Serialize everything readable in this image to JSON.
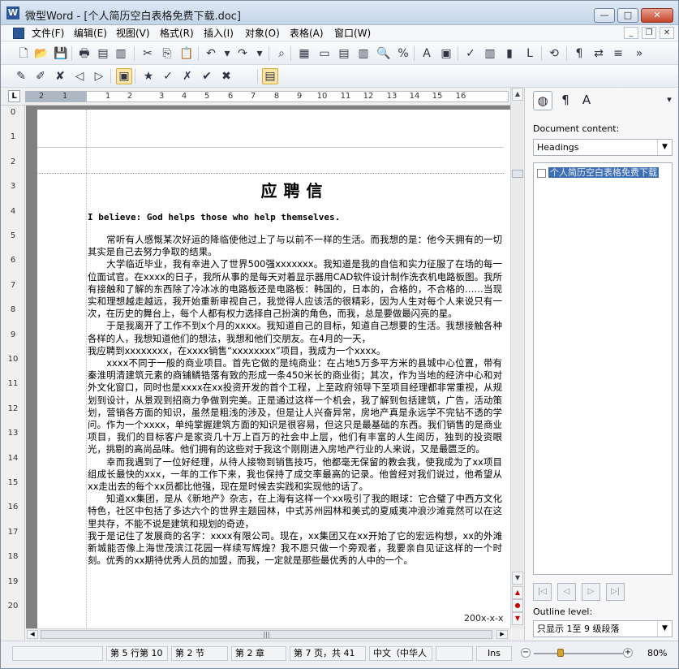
{
  "window": {
    "title": "微型Word - [个人简历空白表格免费下载.doc]",
    "min_glyph": "—",
    "max_glyph": "□",
    "close_glyph": "✕"
  },
  "menu": {
    "items": [
      "文件(F)",
      "编辑(E)",
      "视图(V)",
      "格式(R)",
      "插入(I)",
      "对象(O)",
      "表格(A)",
      "窗口(W)"
    ],
    "mdi_min": "_",
    "mdi_restore": "❐",
    "mdi_close": "✕"
  },
  "toolbar1": {
    "icons": [
      "new-document-icon",
      "open-folder-icon",
      "save-icon",
      "print-icon",
      "pdf-export-icon",
      "print-preview-icon",
      "cut-icon",
      "copy-icon",
      "paste-icon",
      "undo-icon",
      "undo-dropdown-icon",
      "redo-icon",
      "redo-dropdown-icon",
      "find-icon",
      "page-number-icon",
      "insert-frame-icon",
      "insert-table-icon",
      "insert-columns-icon",
      "zoom-icon",
      "percent-icon",
      "font-color-icon",
      "insert-symbol-icon",
      "spell-check-icon",
      "chart-icon",
      "shape-icon",
      "bookmark-icon",
      "sync-icon",
      "paragraph-mark-icon",
      "replace-icon",
      "stack-icon",
      "more-icon"
    ],
    "glyphs": [
      "🗋",
      "📂",
      "💾",
      "🖶",
      "▤",
      "▥",
      "✂",
      "⎘",
      "📋",
      "↶",
      "▾",
      "↷",
      "▾",
      "⌕",
      "▦",
      "▭",
      "▤",
      "▥",
      "🔍",
      "%",
      "A",
      "▣",
      "✓",
      "▥",
      "▮",
      "L",
      "⟲",
      "¶",
      "⇄",
      "≡",
      "»"
    ]
  },
  "toolbar2": {
    "icons": [
      "highlight-icon",
      "edit-note-icon",
      "delete-note-icon",
      "prev-note-icon",
      "next-note-icon",
      "show-notes-icon",
      "track-changes-icon",
      "accept-change-icon",
      "reject-change-icon",
      "accept-all-icon",
      "reject-all-icon",
      "review-pane-icon"
    ],
    "glyphs": [
      "✎",
      "✐",
      "✘",
      "◁",
      "▷",
      "▣",
      "★",
      "✓",
      "✗",
      "✔",
      "✖",
      "▤"
    ]
  },
  "ruler": {
    "corner": "L",
    "h_ticks": [
      "2",
      "1",
      "1",
      "2",
      "3",
      "4",
      "5",
      "6",
      "7",
      "8",
      "9",
      "10",
      "11",
      "12",
      "13",
      "14",
      "15",
      "16"
    ],
    "v_ticks": [
      "0",
      "1",
      "2",
      "3",
      "4",
      "5",
      "6",
      "7",
      "8",
      "9",
      "10",
      "11",
      "12",
      "13",
      "14",
      "15",
      "16",
      "17",
      "18",
      "19",
      "20"
    ]
  },
  "document": {
    "title": "应聘信",
    "motto": "I believe: God helps those who help themselves.",
    "paragraphs": [
      "　　常听有人感慨某次好运的降临使他过上了与以前不一样的生活。而我想的是：他今天拥有的一切其实是自己去努力争取的结果。",
      "　　大学临近毕业，我有幸进入了世界500强xxxxxxx。我知道是我的自信和实力征服了在场的每一位面试官。在xxxx的日子，我所从事的是每天对着显示器用CAD软件设计制作洗衣机电路板图。我所有接触和了解的东西除了冷冰冰的电路板还是电路板：韩国的，日本的，合格的，不合格的……当现实和理想越走越远，我开始重新审视自己，我觉得人应该活的很精彩，因为人生对每个人来说只有一次，在历史的舞台上，每个人都有权力选择自己扮演的角色，而我，总是要做最闪亮的星。",
      "　　于是我离开了工作不到x个月的xxxx。我知道自己的目标，知道自己想要的生活。我想接触各种各样的人，我想知道他们的想法，我想和他们交朋友。在4月的一天，",
      "我应聘到xxxxxxxx，在xxxx销售“xxxxxxxx”项目，我成为一个xxxx。",
      "　　xxxx不同于一般的商业项目。首先它做的是纯商业：在占地5万多平方米的县城中心位置，带有秦淮明清建筑元素的商铺鳞锆落有致的形成一条450米长的商业街；其次，作为当地的经济中心和对外文化窗口，同时也是xxxx在xx投资开发的首个工程，上至政府领导下至项目经理都非常重视，从规划到设计，从景观到招商力争做到完美。正是通过这样一个机会，我了解到包括建筑，广告，活动策划，营销各方面的知识，虽然是粗浅的涉及，但是让人兴奋异常，房地产真是永远学不完钻不透的学问。作为一个xxxx，单纯掌握建筑方面的知识是很容易，但这只是最基础的东西。我们销售的是商业项目，我们的目标客户是家资几十万上百万的社会中上层，他们有丰富的人生阅历，独到的投资眼光，挑剔的高尚品味。他们拥有的这些对于我这个刚刚进入房地产行业的人来说，又是最匮乏的。",
      "　　幸而我遇到了一位好经理，从待人接物到销售技巧，他都毫无保留的教会我，使我成为了xx项目组成长最快的xxx，一年的工作下来，我也保持了成交率最高的记录。他曾经对我们说过，他希望从xx走出去的每个xx员都比他强，现在是时候去实践和实现他的话了。",
      "　　知道xx集团，是从《新地产》杂志，在上海有这样一个xx吸引了我的眼球：它合璧了中西方文化特色，社区中包括了多达六个的世界主题园林，中式苏州园林和美式的夏威夷冲浪沙滩竟然可以在这里共存，不能不说是建筑和规划的奇迹，",
      "我于是记住了发展商的名字：xxxx有限公司。现在，xx集团又在xx开始了它的宏远构想，xx的外滩新城能否像上海世茂滨江花园一样续写辉煌？我不愿只做一个旁观者，我要亲自见证这样的一个时刻。优秀的xx期待优秀人员的加盟，而我，一定就是那些最优秀的人中的一个。"
    ],
    "date": "200x-x-x"
  },
  "panel": {
    "tab_glyphs": [
      "◍",
      "¶",
      "A"
    ],
    "menu_glyph": "▾",
    "content_label": "Document content:",
    "content_value": "Headings",
    "outline_item": "个人简历空白表格免费下载",
    "outline_level_label": "Outline level:",
    "outline_level_value": "只显示 1至 9 级段落",
    "nav_glyphs": [
      "|◁",
      "◁",
      "▷",
      "▷|"
    ]
  },
  "status": {
    "line": "第 5 行第 10",
    "section": "第 2 节",
    "chapter": "第 2 章",
    "page": "第 7 页，共 41",
    "language": "中文（中华人",
    "ins": "Ins",
    "zoom": "80%"
  },
  "zoom_level": 0.3
}
